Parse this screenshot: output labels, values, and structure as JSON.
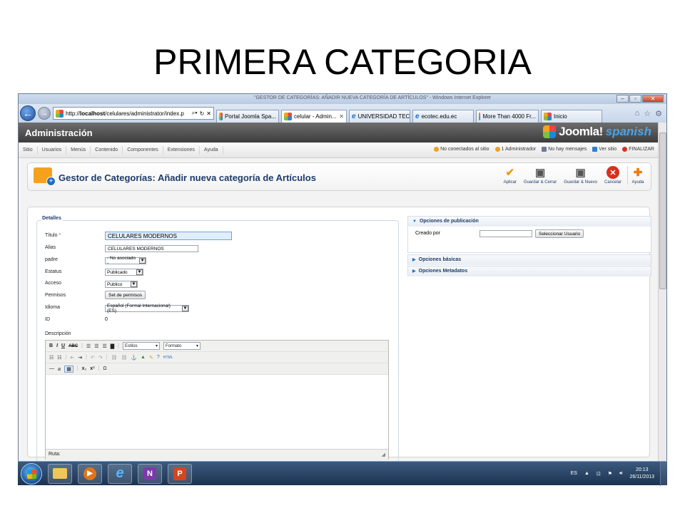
{
  "slide": {
    "title": "PRIMERA CATEGORIA"
  },
  "browser": {
    "caption": "\"GESTOR DE CATEGORÍAS: AÑADIR NUEVA CATEGORÍA DE ARTÍCULOS\" - Windows Internet Explorer",
    "address_prefix": "http://",
    "address_domain": "localhost",
    "address_path": "/celulares/administrator/index.p",
    "tabs": [
      {
        "label": "Portal Joomla Spa...",
        "icon": "joomla-icon",
        "active": false
      },
      {
        "label": "celular - Admin...",
        "icon": "joomla-icon",
        "active": true
      },
      {
        "label": "UNIVERSIDAD TEC...",
        "icon": "ie-icon",
        "active": false
      },
      {
        "label": "ecotec.edu.ec",
        "icon": "ie-icon",
        "active": false
      },
      {
        "label": "More Than 4000 Fr...",
        "icon": "joomla-icon",
        "active": false
      },
      {
        "label": "Inicio",
        "icon": "joomla-icon",
        "active": false
      }
    ]
  },
  "joomla": {
    "header_title": "Administración",
    "logo_text": "Joomla!",
    "logo_suffix": "spanish",
    "menu": [
      "Sitio",
      "Usuarios",
      "Menús",
      "Contenido",
      "Componentes",
      "Extensiones",
      "Ayuda"
    ],
    "status": {
      "not_connected": "No conectados al sitio",
      "admins": "1 Administrador",
      "messages": "No hay mensajes",
      "view_site": "Ver sitio",
      "logout": "FINALIZAR"
    },
    "toolbar": {
      "title": "Gestor de Categorías: Añadir nueva categoría de Artículos",
      "buttons": {
        "apply": "Aplicar",
        "save_close": "Guardar & Cerrar",
        "save_new": "Guardar & Nuevo",
        "cancel": "Cancelar",
        "help": "Ayuda"
      }
    }
  },
  "form": {
    "legend": "Detalles",
    "title_label": "Título",
    "title_required": "*",
    "title_value": "CELULARES MODERNOS",
    "alias_label": "Alias",
    "alias_value": "CELULARES MODERNOS",
    "parent_label": "padre",
    "parent_value": "- No asociado -",
    "status_label": "Estatus",
    "status_value": "Publicado",
    "access_label": "Acceso",
    "access_value": "Publico",
    "permissions_label": "Permisos",
    "permissions_button": "Set de permisos",
    "language_label": "Idioma",
    "language_value": "Español (Formal Internacional) (ES)",
    "id_label": "ID",
    "id_value": "0",
    "description_label": "Descripción",
    "editor": {
      "styles_select": "Estilos",
      "format_select": "Formato",
      "path_label": "Ruta:"
    }
  },
  "side_panels": {
    "publishing": "Opciones de publicación",
    "created_by_label": "Creado por",
    "select_user_button": "Seleccionar Usuario",
    "basic": "Opciones básicas",
    "metadata": "Opciones Metadatos"
  },
  "taskbar": {
    "lang": "ES",
    "time": "20:13",
    "date": "26/11/2013"
  }
}
